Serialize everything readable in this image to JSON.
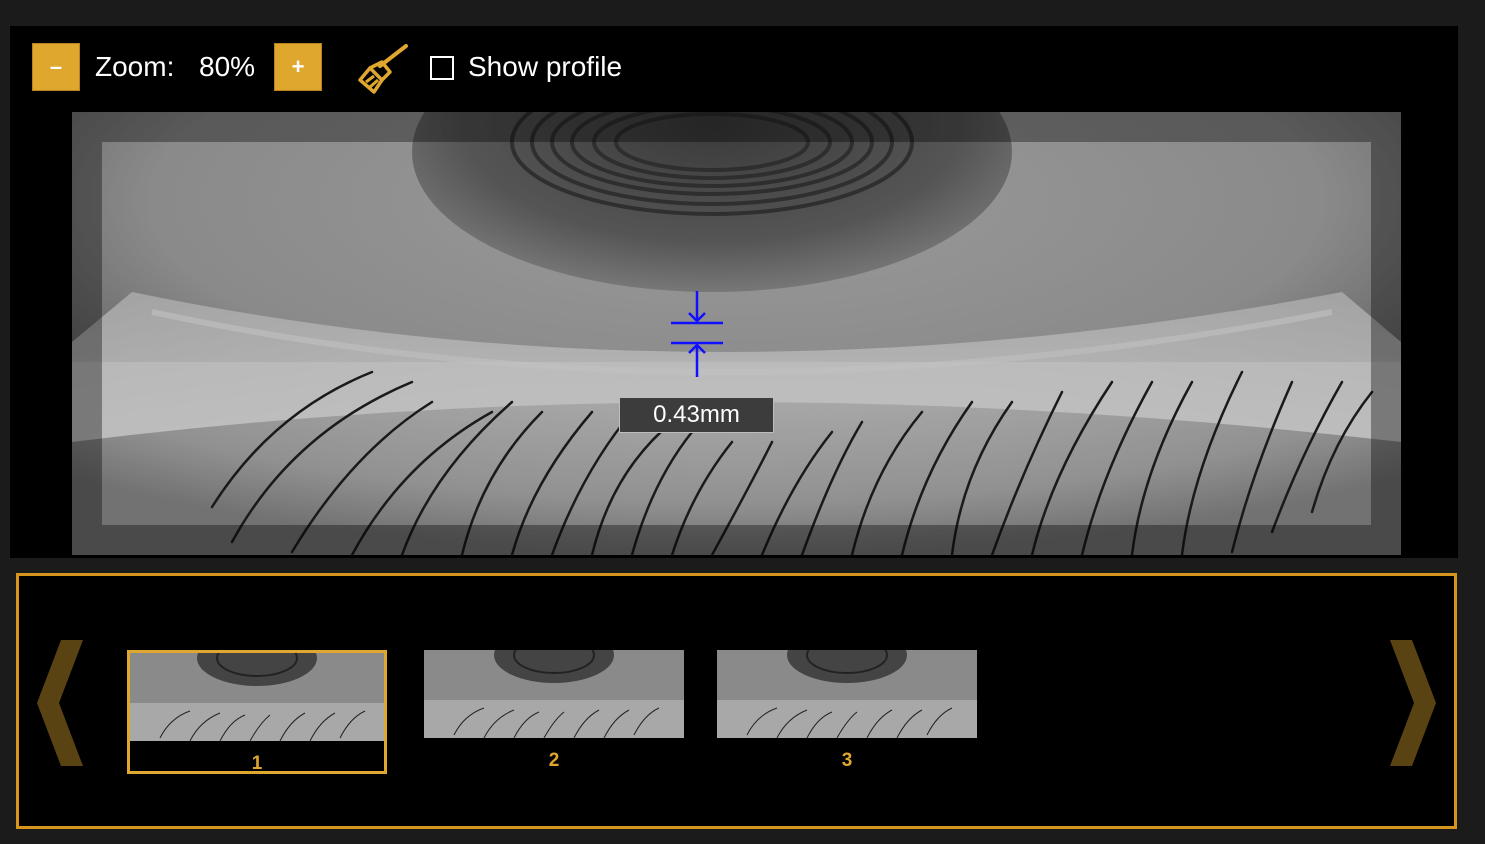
{
  "toolbar": {
    "zoom_label": "Zoom:",
    "zoom_value": "80%",
    "minus_label": "–",
    "plus_label": "+",
    "show_profile_label": "Show profile",
    "show_profile_checked": false
  },
  "viewer": {
    "measurement": "0.43mm",
    "marker_color": "#1010ff"
  },
  "thumbnails": [
    {
      "label": "1",
      "selected": true
    },
    {
      "label": "2",
      "selected": false
    },
    {
      "label": "3",
      "selected": false
    }
  ],
  "colors": {
    "accent": "#e0a72f",
    "strip_border": "#d8951d",
    "arrow": "#5a4312"
  },
  "icons": {
    "clear": "broom-icon",
    "prev": "chevron-left-icon",
    "next": "chevron-right-icon"
  }
}
